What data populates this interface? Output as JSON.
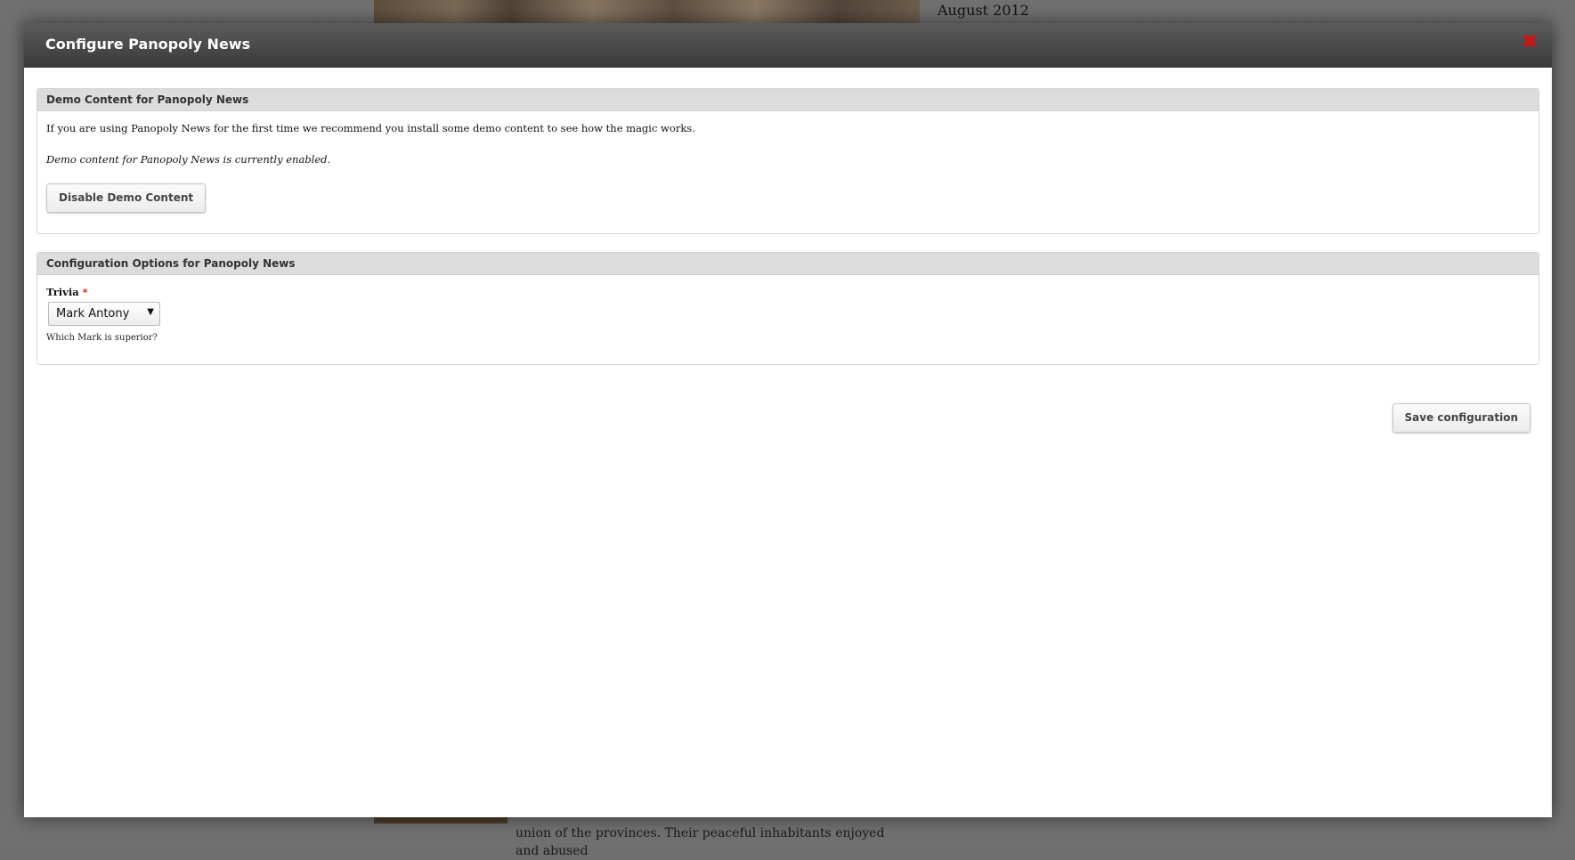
{
  "background": {
    "date": "August 2012",
    "article_snippet": "union of the provinces. Their peaceful inhabitants enjoyed and abused"
  },
  "modal": {
    "title": "Configure Panopoly News",
    "close_icon": "close-icon"
  },
  "demo_section": {
    "legend": "Demo Content for Panopoly News",
    "intro": "If you are using Panopoly News for the first time we recommend you install some demo content to see how the magic works.",
    "status": "Demo content for Panopoly News is currently enabled.",
    "button_label": "Disable Demo Content"
  },
  "config_section": {
    "legend": "Configuration Options for Panopoly News",
    "field_label": "Trivia",
    "required_marker": "*",
    "select_value": "Mark Antony",
    "description": "Which Mark is superior?"
  },
  "actions": {
    "save_label": "Save configuration"
  },
  "colors": {
    "header_dark": "#3a3a3a",
    "close_red": "#d41111",
    "legend_bg": "#dcdcdc"
  }
}
